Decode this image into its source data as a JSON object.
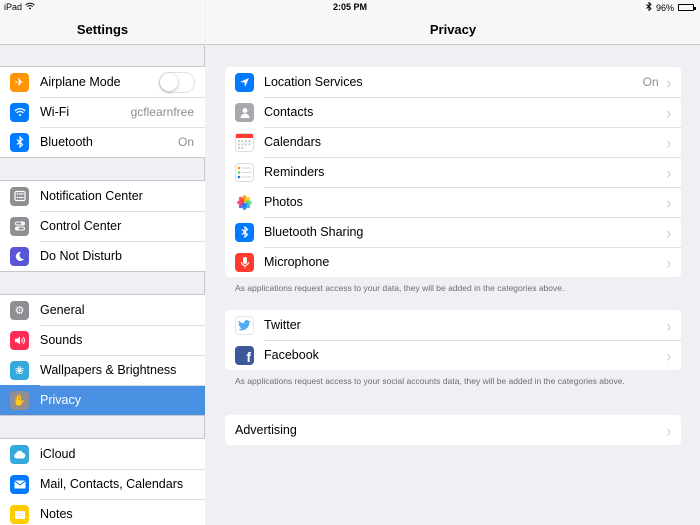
{
  "status": {
    "device": "iPad",
    "time": "2:05 PM",
    "battery_text": "96%",
    "battery_level": 0.96
  },
  "sidebar": {
    "title": "Settings",
    "groups": [
      {
        "items": [
          {
            "label": "Airplane Mode",
            "icon": "airplane-icon",
            "color": "#ff9500",
            "toggle": "off"
          },
          {
            "label": "Wi-Fi",
            "icon": "wifi-icon",
            "color": "#007aff",
            "value": "gcflearnfree"
          },
          {
            "label": "Bluetooth",
            "icon": "bluetooth-icon",
            "color": "#007aff",
            "value": "On"
          }
        ]
      },
      {
        "items": [
          {
            "label": "Notification Center",
            "icon": "notification-center-icon",
            "color": "#8e8e93"
          },
          {
            "label": "Control Center",
            "icon": "control-center-icon",
            "color": "#8e8e93"
          },
          {
            "label": "Do Not Disturb",
            "icon": "moon-icon",
            "color": "#5856d6"
          }
        ]
      },
      {
        "items": [
          {
            "label": "General",
            "icon": "gear-icon",
            "color": "#8e8e93"
          },
          {
            "label": "Sounds",
            "icon": "speaker-icon",
            "color": "#ff2d55"
          },
          {
            "label": "Wallpapers & Brightness",
            "icon": "wallpaper-icon",
            "color": "#34aadc"
          },
          {
            "label": "Privacy",
            "icon": "hand-icon",
            "color": "#8e8e93",
            "selected": true
          }
        ]
      },
      {
        "items": [
          {
            "label": "iCloud",
            "icon": "cloud-icon",
            "color": "#34aadc"
          },
          {
            "label": "Mail, Contacts, Calendars",
            "icon": "mail-icon",
            "color": "#007aff"
          },
          {
            "label": "Notes",
            "icon": "notes-icon",
            "color": "#ffcc00"
          }
        ]
      }
    ]
  },
  "main": {
    "title": "Privacy",
    "section1": {
      "items": [
        {
          "label": "Location Services",
          "icon": "location-arrow-icon",
          "color": "#007aff",
          "value": "On"
        },
        {
          "label": "Contacts",
          "icon": "contacts-icon",
          "color": "#8e8e93"
        },
        {
          "label": "Calendars",
          "icon": "calendar-icon",
          "color": "#ff3b30"
        },
        {
          "label": "Reminders",
          "icon": "reminders-icon",
          "color": "#ff9500"
        },
        {
          "label": "Photos",
          "icon": "photos-icon",
          "color": "#ff9500"
        },
        {
          "label": "Bluetooth Sharing",
          "icon": "bluetooth-icon",
          "color": "#007aff"
        },
        {
          "label": "Microphone",
          "icon": "microphone-icon",
          "color": "#ff3b30"
        }
      ],
      "footnote": "As applications request access to your data, they will be added in the categories above."
    },
    "section2": {
      "items": [
        {
          "label": "Twitter",
          "icon": "twitter-icon",
          "color": "#55acee"
        },
        {
          "label": "Facebook",
          "icon": "facebook-icon",
          "color": "#3b5998"
        }
      ],
      "footnote": "As applications request access to your social accounts data, they will be added in the categories above."
    },
    "section3": {
      "items": [
        {
          "label": "Advertising"
        }
      ]
    }
  }
}
